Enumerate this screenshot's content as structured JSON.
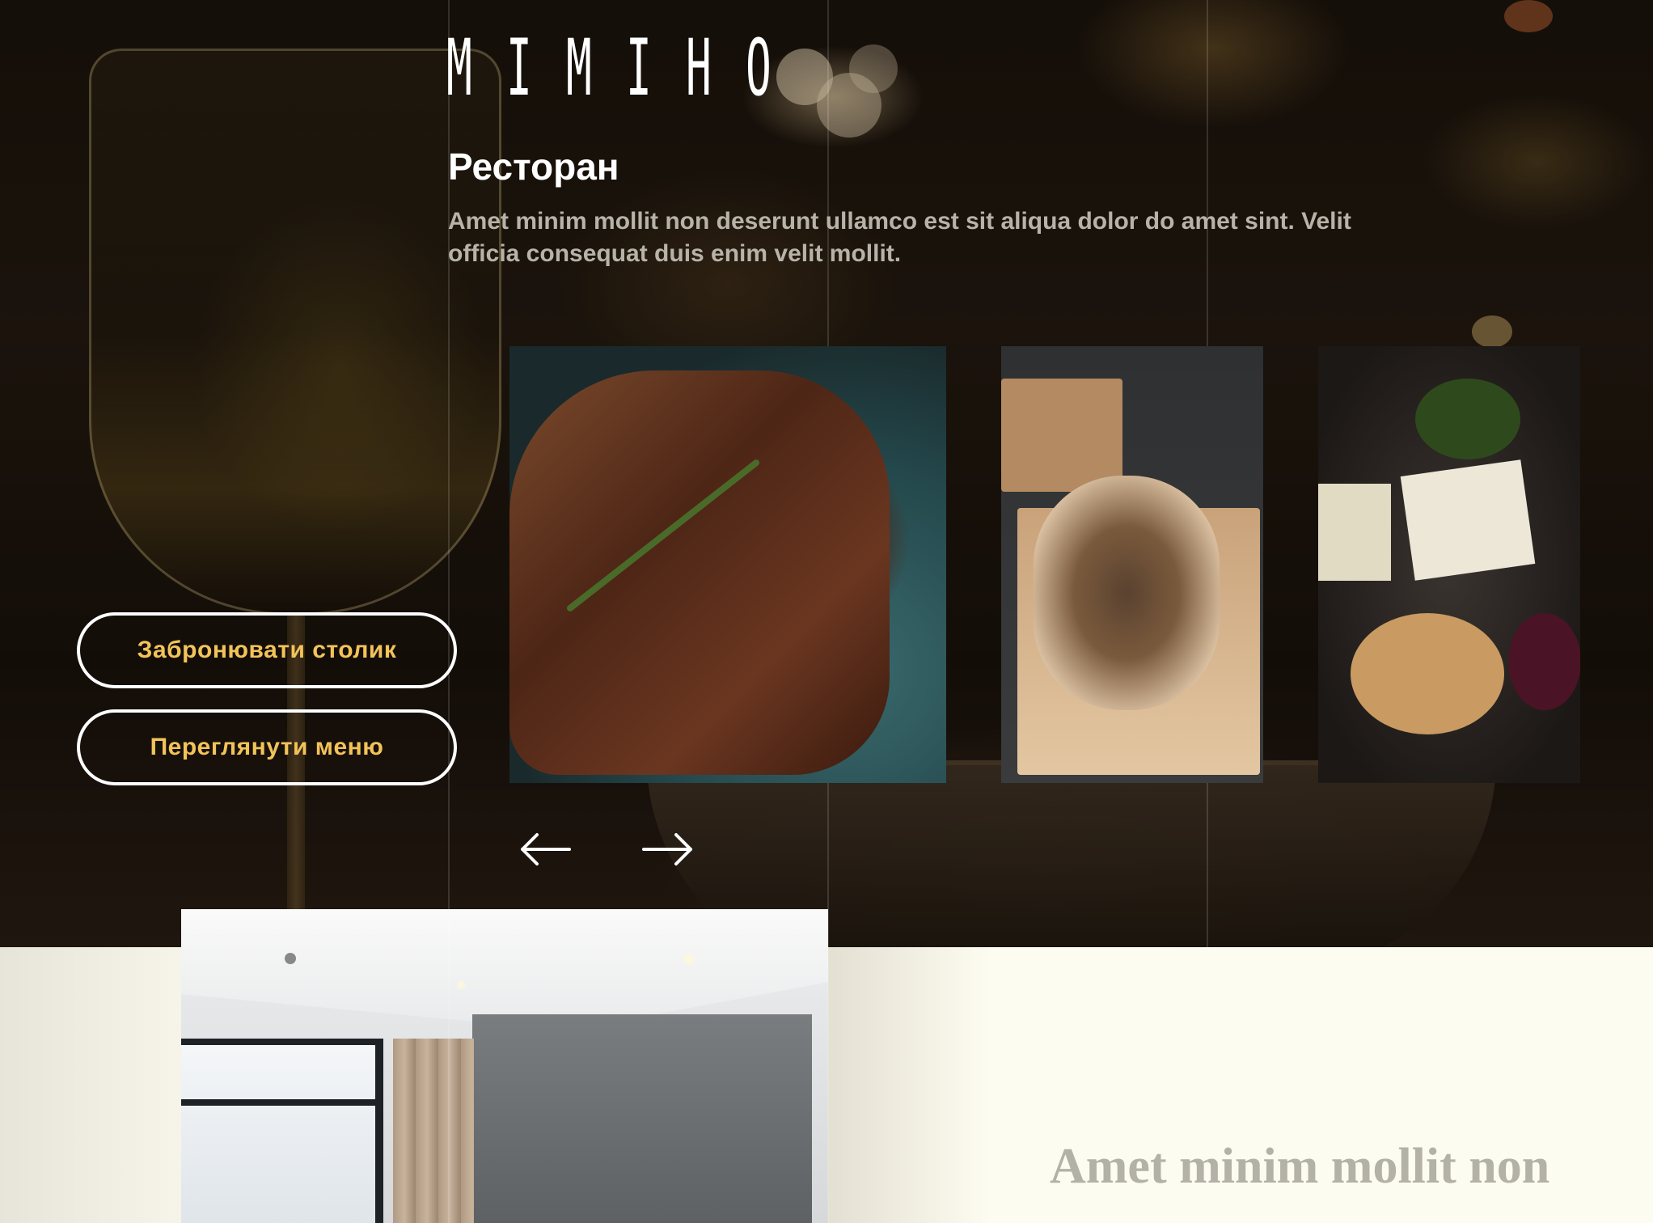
{
  "brand": {
    "logo_letters": [
      "M",
      "I",
      "M",
      "I",
      "H",
      "O"
    ]
  },
  "hero": {
    "title": "Ресторан",
    "description": "Amet minim mollit non deserunt ullamco est sit aliqua dolor do amet sint. Velit officia consequat duis enim velit mollit."
  },
  "actions": {
    "book_label": "Забронювати столик",
    "menu_label": "Переглянути меню"
  },
  "gallery": {
    "photos": [
      "steak-photo",
      "grilled-flatbread-photo",
      "cheese-plate-photo"
    ],
    "prev_icon": "arrow-left-icon",
    "next_icon": "arrow-right-icon"
  },
  "next_section": {
    "heading": "Amet minim mollit non",
    "image": "hotel-room-photo"
  },
  "colors": {
    "accent": "#f2c35a",
    "hero_text": "#ffffff",
    "muted_text": "#b8b3a9",
    "section_background": "#fdfcf0"
  }
}
